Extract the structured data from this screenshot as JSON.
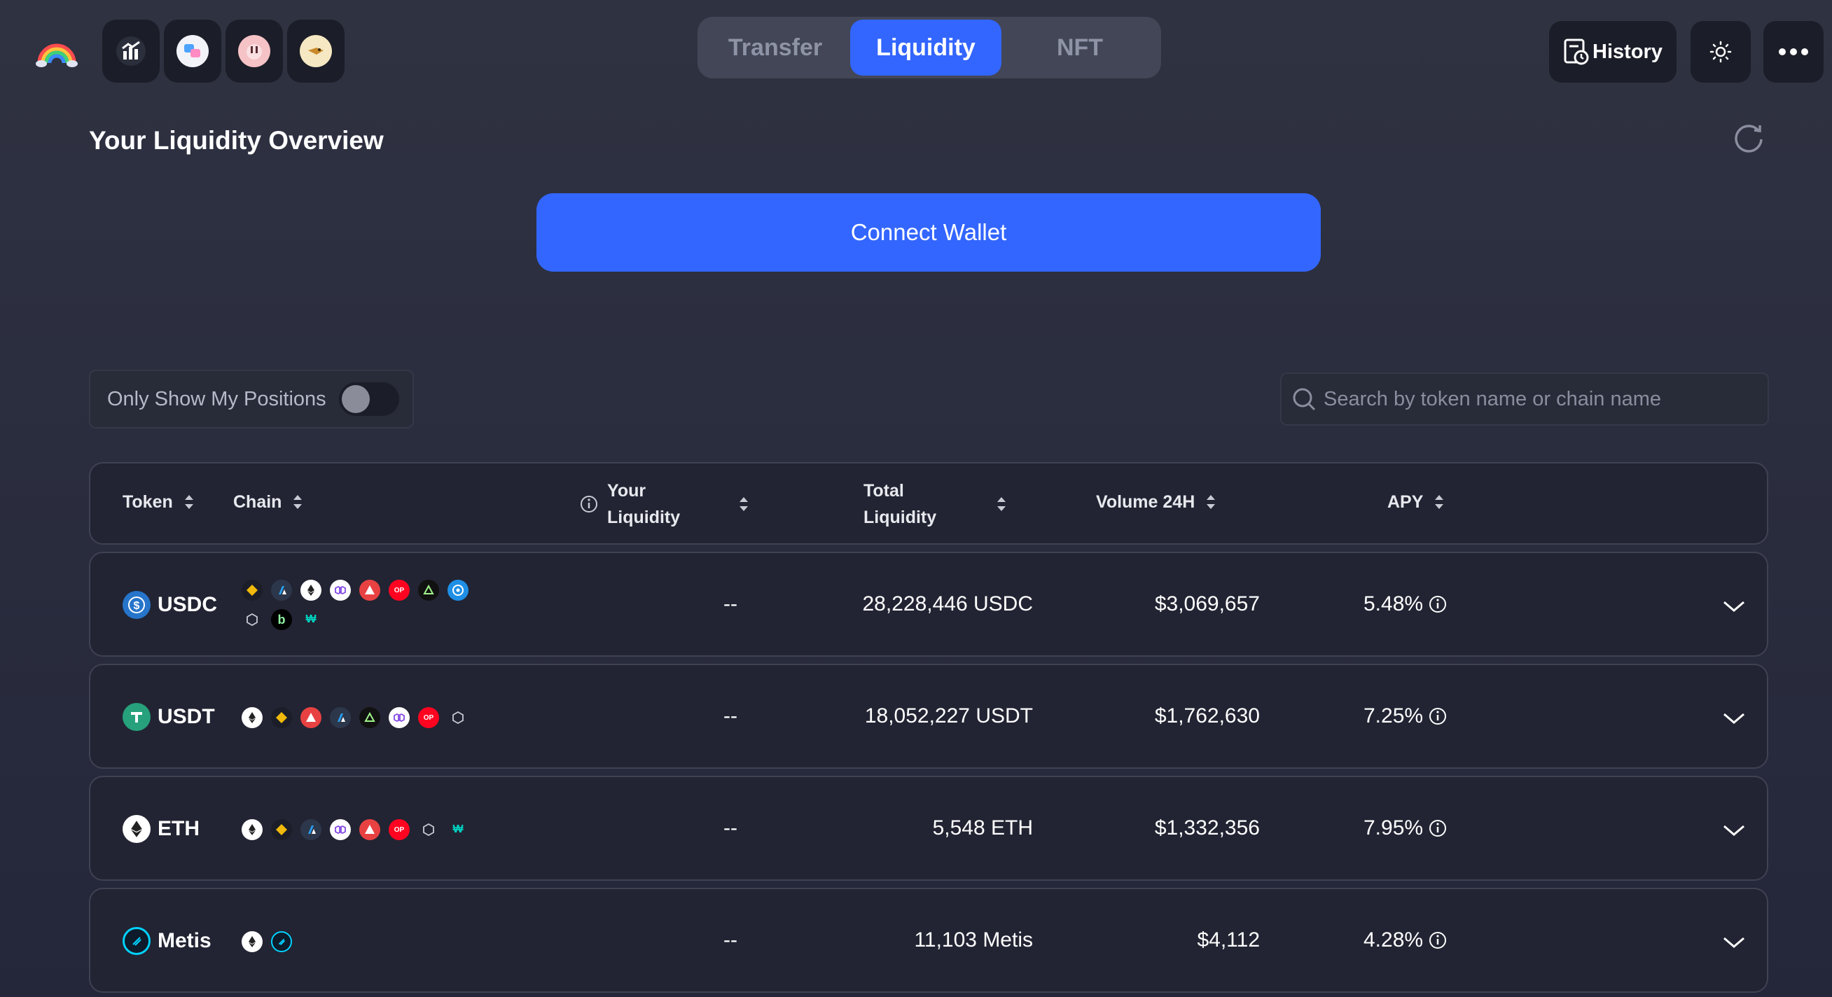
{
  "tabs": [
    {
      "label": "Transfer",
      "active": false
    },
    {
      "label": "Liquidity",
      "active": true
    },
    {
      "label": "NFT",
      "active": false
    }
  ],
  "header": {
    "history_label": "History",
    "theme_icon": "sun-icon",
    "menu_icon": "more-icon"
  },
  "page": {
    "title": "Your Liquidity Overview",
    "connect_label": "Connect Wallet",
    "only_my_positions_label": "Only Show My Positions",
    "only_my_positions_on": false,
    "search_placeholder": "Search by token name or chain name"
  },
  "table": {
    "columns": {
      "token": "Token",
      "chain": "Chain",
      "your_liquidity_1": "Your",
      "your_liquidity_2": "Liquidity",
      "total_liquidity_1": "Total",
      "total_liquidity_2": "Liquidity",
      "volume": "Volume 24H",
      "apy": "APY"
    },
    "rows": [
      {
        "token": "USDC",
        "your": "--",
        "total": "28,228,446 USDC",
        "volume": "$3,069,657",
        "apy": "5.48%"
      },
      {
        "token": "USDT",
        "your": "--",
        "total": "18,052,227 USDT",
        "volume": "$1,762,630",
        "apy": "7.25%"
      },
      {
        "token": "ETH",
        "your": "--",
        "total": "5,548 ETH",
        "volume": "$1,332,356",
        "apy": "7.95%"
      },
      {
        "token": "Metis",
        "your": "--",
        "total": "11,103 Metis",
        "volume": "$4,112",
        "apy": "4.28%"
      }
    ]
  },
  "colors": {
    "accent": "#3366ff",
    "background": "#2a2d3c",
    "card": "#222433"
  }
}
